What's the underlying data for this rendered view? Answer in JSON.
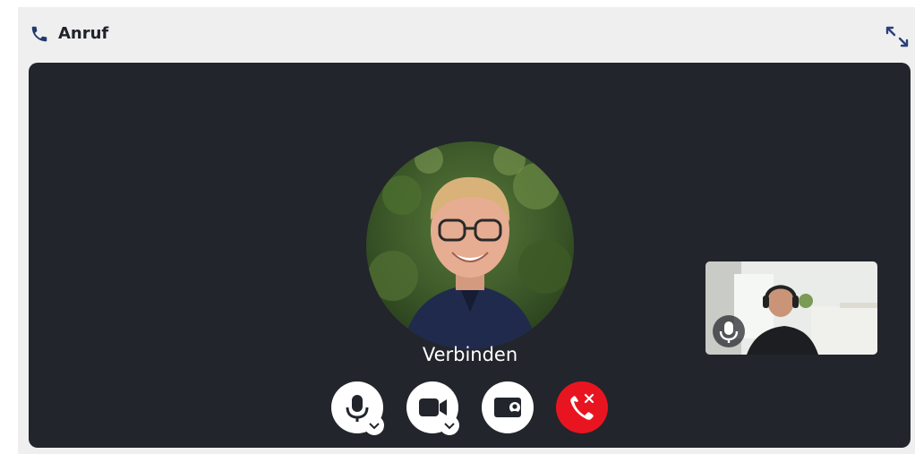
{
  "header": {
    "title": "Anruf",
    "icon": "phone-icon",
    "expand_icon": "expand-icon"
  },
  "call": {
    "status": "Verbinden",
    "remote_avatar": "participant-photo",
    "self_view": "self-video-preview",
    "self_mic_icon": "microphone-icon"
  },
  "controls": [
    {
      "name": "microphone-button",
      "icon": "microphone-icon",
      "has_options": true
    },
    {
      "name": "camera-button",
      "icon": "video-camera-icon",
      "has_options": true
    },
    {
      "name": "screen-share-button",
      "icon": "screen-share-icon",
      "has_options": false
    },
    {
      "name": "hang-up-button",
      "icon": "phone-hangup-icon",
      "has_options": false
    }
  ],
  "colors": {
    "stage_bg": "#22252c",
    "hangup": "#e81520",
    "header_bg": "#efefef",
    "accent": "#1f3a6e"
  }
}
